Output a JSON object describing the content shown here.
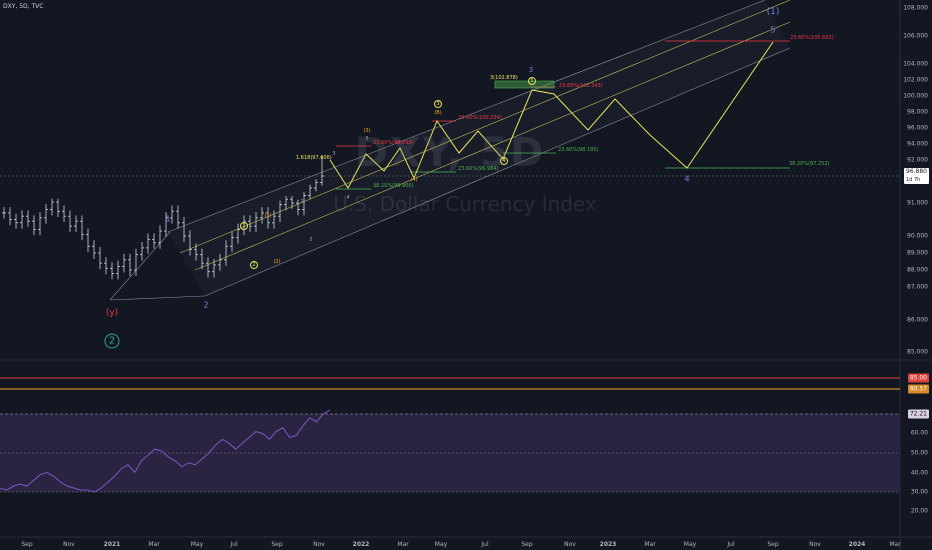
{
  "symbol": "DXY, 5D, TVC",
  "watermark": {
    "ticker": "DXY, 5D",
    "name": "U.S. Dollar Currency Index"
  },
  "colors": {
    "background": "#131722",
    "bar": "#d1d4dc",
    "projection": "#e8e35b",
    "channel": "#8d8d99",
    "channel_mid": "#c9c05a",
    "fib_red": "#f23645",
    "fib_green": "#4caf50",
    "wave_blue": "#7e7be8",
    "wave_orange": "#f5a623",
    "wave_red": "#f23645",
    "wave_green": "#26a69a",
    "rsi_line": "#7e57c2",
    "rsi_fill": "#2a2442",
    "last_price": "#ffffff",
    "hline_red": "#e0413a",
    "hline_orange": "#f0a030"
  },
  "price_axis": {
    "ticks": [
      "108.000",
      "106.000",
      "104.000",
      "102.000",
      "100.000",
      "98.000",
      "96.000",
      "94.000",
      "92.000",
      "91.000",
      "90.000",
      "89.000",
      "88.000",
      "87.000",
      "86.000",
      "85.000"
    ]
  },
  "last_price": "96.880",
  "last_price_sub": "1d 7h",
  "indicator_axis": {
    "ticks": [
      "60.00",
      "50.00",
      "40.00",
      "30.00",
      "20.00"
    ],
    "badge_rsi": "72.21",
    "badge_top": "85.00",
    "badge_mid": "80.57"
  },
  "time_axis": {
    "labels": [
      "Sep",
      "Nov",
      "2021",
      "Mar",
      "May",
      "Jul",
      "Sep",
      "Nov",
      "2022",
      "Mar",
      "May",
      "Jul",
      "Sep",
      "Nov",
      "2023",
      "Mar",
      "May",
      "Jul",
      "Sep",
      "Nov",
      "2024",
      "Mar"
    ]
  },
  "annotations": {
    "fib_red_1": "23.60%(105.602)",
    "fib_green_1": "38.20%(97.252)",
    "fib_red_2": "23.60%(102.343)",
    "fib_green_2": "23.60%(98.185)",
    "fib_red_3": "23.60%(100.234)",
    "fib_green_3": "23.60%(96.984)",
    "fib_red_4": "23.60%(98.899)",
    "fib_green_4": "38.20%(95.906)",
    "ext_1": "1.618(97.606)",
    "ext_2": "3(102.878)",
    "big_wave_1": "(1)",
    "big_wave_2": "2",
    "wave_y": "(y)",
    "wave_1": "1",
    "wave_2": "2",
    "wave_3": "3",
    "wave_4": "4",
    "wave_5": "5",
    "sub_1": "1",
    "sub_2": "2",
    "sub_3": "3",
    "sub_4": "4",
    "sub_5": "5",
    "sub_i": "(1)",
    "sub_ii": "(2)",
    "sub_iii": "(3)",
    "sub_iv": "(4)",
    "sub_v": "(5)",
    "sub_b": "(B)",
    "small_1": "1",
    "small_2": "2",
    "small_3": "3",
    "small_4": "4",
    "small_5": "5"
  },
  "chart_data": {
    "type": "line",
    "title": "",
    "xlabel": "",
    "ylabel": "",
    "ylim": [
      85,
      108
    ],
    "series": [
      {
        "values": [
          93.4,
          93.0,
          92.8,
          93.2,
          92.9,
          92.4,
          93.1,
          93.6,
          94.1,
          93.5,
          93.2,
          92.6,
          92.9,
          92.1,
          91.4,
          91.0,
          90.4,
          90.1,
          89.8,
          90.2,
          90.6,
          90.0,
          90.9,
          91.3,
          91.8,
          91.6,
          92.3,
          93.1,
          93.5,
          92.8,
          92.0,
          91.2,
          90.9,
          90.4,
          89.9,
          90.3,
          90.6,
          91.4,
          91.9,
          92.4,
          92.9,
          92.6,
          93.1,
          93.4,
          92.8,
          93.2,
          93.9,
          94.4,
          94.0,
          93.6,
          94.8,
          95.6,
          96.2,
          96.88
        ]
      }
    ],
    "rsi": [
      32,
      31,
      33,
      34,
      33,
      36,
      39,
      40,
      38,
      35,
      33,
      32,
      31,
      31,
      30,
      32,
      35,
      38,
      42,
      44,
      40,
      46,
      49,
      52,
      51,
      48,
      46,
      43,
      45,
      44,
      47,
      50,
      54,
      57,
      55,
      52,
      55,
      58,
      61,
      60,
      57,
      61,
      63,
      58,
      59,
      64,
      68,
      66,
      70,
      72
    ]
  }
}
